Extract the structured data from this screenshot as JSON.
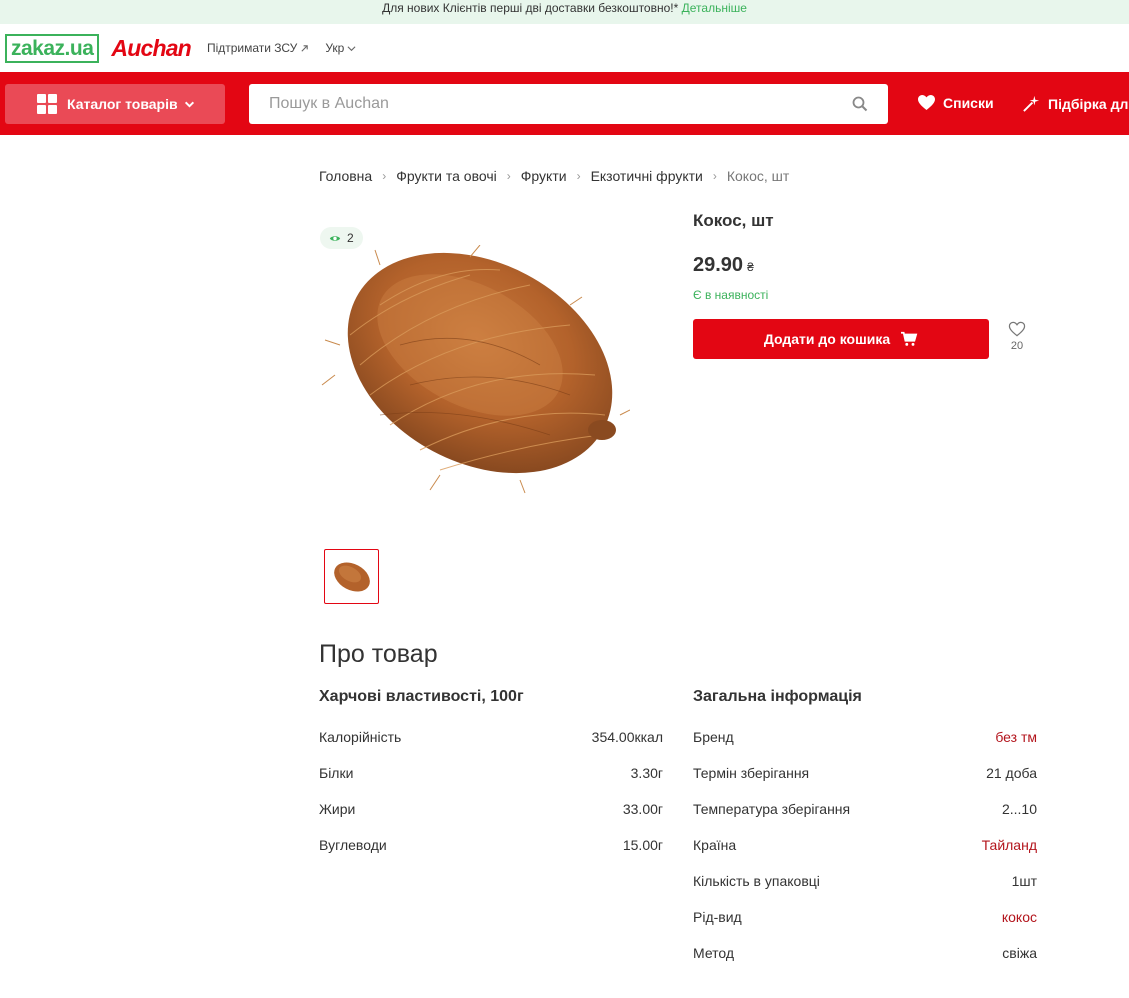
{
  "promo": {
    "text": "Для нових Клієнтів перші дві доставки безкоштовно!*",
    "link": "Детальніше"
  },
  "header": {
    "logo_zakaz": "zakaz.ua",
    "logo_auchan": "Auchan",
    "support_link": "Підтримати ЗСУ",
    "language": "Укр"
  },
  "nav": {
    "catalog_label": "Каталог товарів",
    "search_placeholder": "Пошук в Auchan",
    "lists_label": "Списки",
    "selection_label": "Підбірка дл"
  },
  "breadcrumb": [
    "Головна",
    "Фрукти та овочі",
    "Фрукти",
    "Екзотичні фрукти",
    "Кокос, шт"
  ],
  "product": {
    "views": "2",
    "title": "Кокос, шт",
    "price": "29.90",
    "currency": "₴",
    "stock": "Є в наявності",
    "add_to_cart": "Додати до кошика",
    "favorites_count": "20"
  },
  "about": {
    "title": "Про товар",
    "nutrition": {
      "title": "Харчові властивості, 100г",
      "rows": [
        {
          "label": "Калорійність",
          "value": "354.00ккал"
        },
        {
          "label": "Білки",
          "value": "3.30г"
        },
        {
          "label": "Жири",
          "value": "33.00г"
        },
        {
          "label": "Вуглеводи",
          "value": "15.00г"
        }
      ]
    },
    "general": {
      "title": "Загальна інформація",
      "rows": [
        {
          "label": "Бренд",
          "value": "без тм"
        },
        {
          "label": "Термін зберігання",
          "value": "21 доба"
        },
        {
          "label": "Температура зберігання",
          "value": "2...10"
        },
        {
          "label": "Країна",
          "value": "Тайланд"
        },
        {
          "label": "Кількість в упаковці",
          "value": "1шт"
        },
        {
          "label": "Рід-вид",
          "value": "кокос"
        },
        {
          "label": "Метод",
          "value": "свіжа"
        }
      ]
    }
  },
  "colors": {
    "brand_red": "#e30613",
    "green": "#3bb25b",
    "link_red": "#b3141c"
  }
}
